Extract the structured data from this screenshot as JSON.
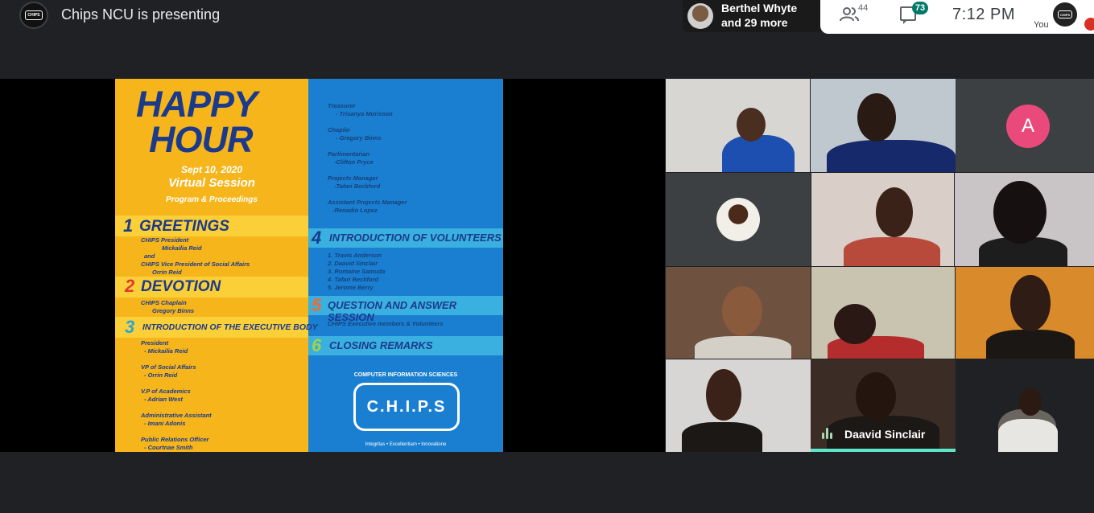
{
  "topbar": {
    "presenting_title": "Chips NCU is presenting",
    "participants_names_line1": "Berthel Whyte",
    "participants_names_line2": "and 29 more",
    "people_count": "44",
    "chat_badge": "73",
    "time": "7:12  PM",
    "self_label": "You",
    "logo_text": "CHIPS"
  },
  "slide": {
    "title_line1": "HAPPY",
    "title_line2": "HOUR",
    "date": "Sept 10, 2020",
    "session": "Virtual Session",
    "subtitle": "Program & Proceedings",
    "sections": [
      {
        "num": "1",
        "title": "GREETINGS"
      },
      {
        "num": "2",
        "title": "DEVOTION"
      },
      {
        "num": "3",
        "title": "INTRODUCTION OF THE EXECUTIVE BODY"
      },
      {
        "num": "4",
        "title": "INTRODUCTION OF VOLUNTEERS"
      },
      {
        "num": "5",
        "title": "QUESTION AND ANSWER SESSION"
      },
      {
        "num": "6",
        "title": "CLOSING REMARKS"
      }
    ],
    "greetings": [
      "CHIPS President",
      "Mickailia Reid",
      "and",
      "CHIPS Vice President of Social Affairs",
      "Orrin Reid"
    ],
    "devotion": [
      "CHIPS Chaplain",
      "Gregory Binns"
    ],
    "exec": [
      "President",
      "- Mickailia Reid",
      "VP of Social Affairs",
      "- Orrin Reid",
      "V.P of Academics",
      "- Adrian West",
      "Administrative Assistant",
      "- Imani Adonis",
      "Public Relations Officer",
      "- Courtnae Smith"
    ],
    "exec_right": [
      "Treasurer",
      "- Trisanya Morisson",
      "Chaplin",
      "- Gregory Binns",
      "Parlimentarian",
      "-Clifton Pryce",
      "Projects Manager",
      "-Tafari Beckford",
      "Assistant Projects Manager",
      "-Renadio Lopez"
    ],
    "volunteers": [
      "1. Travis Anderson",
      "2. Daavid Sinclair",
      "3. Romaine Samuda",
      "4. Tafari Beckford",
      "5. Jerome Berry"
    ],
    "qa_note": "CHIPS Executive members & Volunteers",
    "cis_label": "COMPUTER INFORMATION SCIENCES",
    "logo_text": "C.H.I.P.S",
    "motto": "Integritas  •  Excellentiam  •  Innovatione"
  },
  "grid": {
    "initial": "A",
    "active_speaker": "Daavid Sinclair"
  },
  "colors": {
    "slide_yellow": "#f5b51b",
    "slide_blue": "#1a7fd1",
    "title_navy": "#1b3a8c",
    "avatar_pink": "#ea4a7b",
    "active_speaker_bar": "#5ee6c9"
  }
}
